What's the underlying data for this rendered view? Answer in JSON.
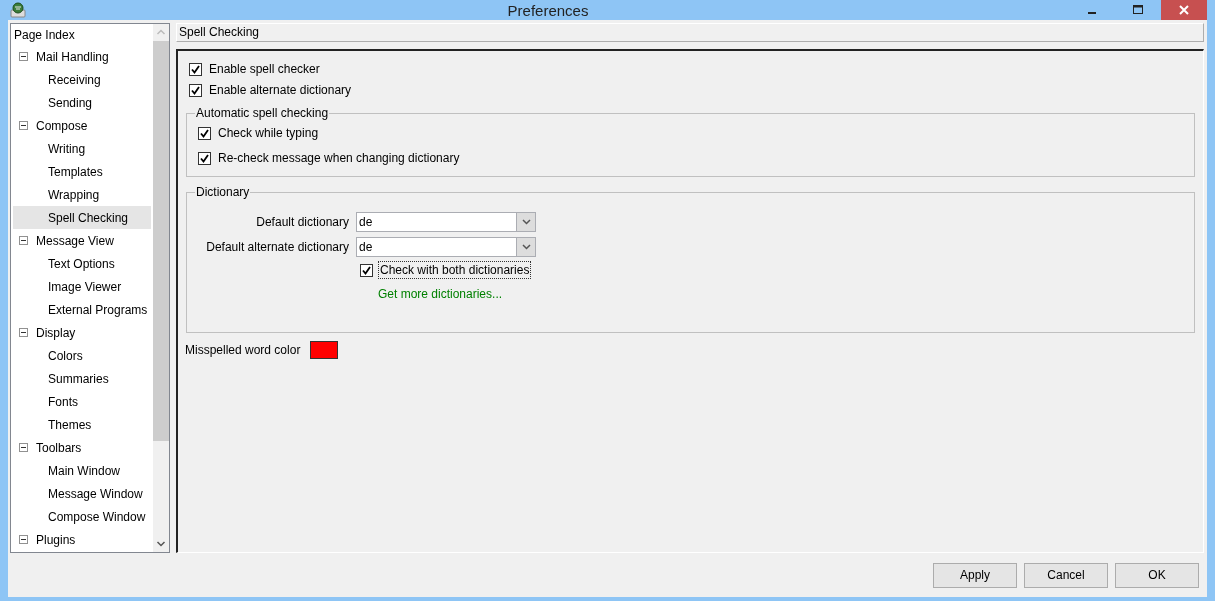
{
  "window": {
    "title": "Preferences"
  },
  "sidebar": {
    "header": "Page Index",
    "items": [
      {
        "label": "Mail Handling",
        "expanded": true,
        "selected": false,
        "children": [
          {
            "label": "Receiving",
            "selected": false
          },
          {
            "label": "Sending",
            "selected": false
          }
        ]
      },
      {
        "label": "Compose",
        "expanded": true,
        "selected": false,
        "children": [
          {
            "label": "Writing",
            "selected": false
          },
          {
            "label": "Templates",
            "selected": false
          },
          {
            "label": "Wrapping",
            "selected": false
          },
          {
            "label": "Spell Checking",
            "selected": true
          }
        ]
      },
      {
        "label": "Message View",
        "expanded": true,
        "selected": false,
        "children": [
          {
            "label": "Text Options",
            "selected": false
          },
          {
            "label": "Image Viewer",
            "selected": false
          },
          {
            "label": "External Programs",
            "selected": false
          }
        ]
      },
      {
        "label": "Display",
        "expanded": true,
        "selected": false,
        "children": [
          {
            "label": "Colors",
            "selected": false
          },
          {
            "label": "Summaries",
            "selected": false
          },
          {
            "label": "Fonts",
            "selected": false
          },
          {
            "label": "Themes",
            "selected": false
          }
        ]
      },
      {
        "label": "Toolbars",
        "expanded": true,
        "selected": false,
        "children": [
          {
            "label": "Main Window",
            "selected": false
          },
          {
            "label": "Message Window",
            "selected": false
          },
          {
            "label": "Compose Window",
            "selected": false
          }
        ]
      },
      {
        "label": "Plugins",
        "expanded": true,
        "selected": false
      }
    ]
  },
  "page": {
    "title": "Spell Checking",
    "options": [
      {
        "label": "Enable spell checker",
        "checked": true
      },
      {
        "label": "Enable alternate dictionary",
        "checked": true
      }
    ],
    "automatic": {
      "title": "Automatic spell checking",
      "options": [
        {
          "label": "Check while typing",
          "checked": true
        },
        {
          "label": "Re-check message when changing dictionary",
          "checked": true
        }
      ]
    },
    "dictionary": {
      "title": "Dictionary",
      "fields": [
        {
          "label": "Default dictionary",
          "value": "de"
        },
        {
          "label": "Default alternate dictionary",
          "value": "de"
        }
      ],
      "both": {
        "label": "Check with both dictionaries",
        "checked": true,
        "focused": true
      },
      "link": "Get more dictionaries..."
    },
    "misspelled": {
      "label": "Misspelled word color",
      "color": "#ff0000"
    }
  },
  "buttons": [
    "Apply",
    "Cancel",
    "OK"
  ]
}
